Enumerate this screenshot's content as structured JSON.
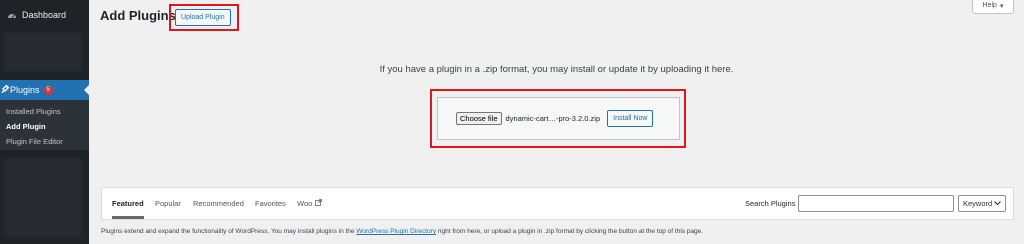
{
  "sidebar": {
    "dashboard_label": "Dashboard",
    "plugins_label": "Plugins",
    "plugins_badge": "5",
    "submenu": [
      "Installed Plugins",
      "Add Plugin",
      "Plugin File Editor"
    ]
  },
  "header": {
    "title": "Add Plugins",
    "upload_button": "Upload Plugin",
    "help_label": "Help"
  },
  "upload": {
    "instruction": "If you have a plugin in a .zip format, you may install or update it by uploading it here.",
    "choose_file_label": "Choose file",
    "file_name": "dynamic-cart…-pro-3.2.0.zip",
    "install_button": "Install Now"
  },
  "filter": {
    "tabs": [
      "Featured",
      "Popular",
      "Recommended",
      "Favorites",
      "Woo"
    ],
    "search_label": "Search Plugins",
    "search_value": "",
    "search_type": "Keyword"
  },
  "footer": {
    "text_before": "Plugins extend and expand the functionality of WordPress. You may install plugins in the ",
    "link": "WordPress Plugin Directory",
    "text_after": " right from here, or upload a plugin in .zip format by clicking the button at the top of this page."
  },
  "colors": {
    "sidebar_bg": "#1d2327",
    "accent": "#2271b1",
    "highlight": "#e0161f",
    "badge": "#d63638"
  }
}
